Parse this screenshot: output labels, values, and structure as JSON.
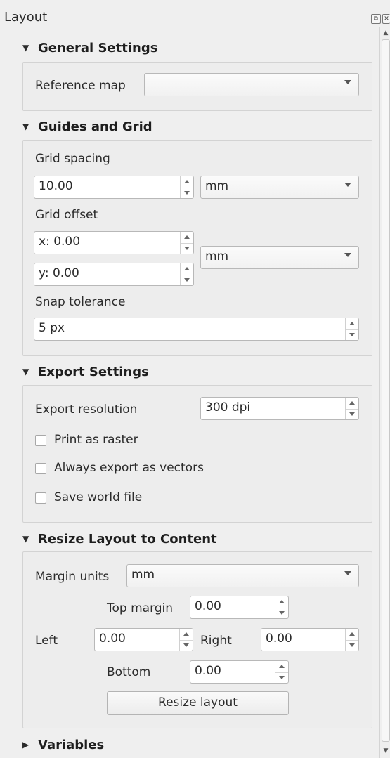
{
  "panel": {
    "title": "Layout"
  },
  "general": {
    "header": "General Settings",
    "reference_map_label": "Reference map",
    "reference_map_value": ""
  },
  "guides": {
    "header": "Guides and Grid",
    "grid_spacing_label": "Grid spacing",
    "grid_spacing_value": "10.00",
    "grid_spacing_unit": "mm",
    "grid_offset_label": "Grid offset",
    "offset_x": "x: 0.00",
    "offset_y": "y: 0.00",
    "offset_unit": "mm",
    "snap_label": "Snap tolerance",
    "snap_value": "5 px"
  },
  "export": {
    "header": "Export Settings",
    "resolution_label": "Export resolution",
    "resolution_value": "300 dpi",
    "print_raster": "Print as raster",
    "always_vectors": "Always export as vectors",
    "world_file": "Save world file"
  },
  "resize": {
    "header": "Resize Layout to Content",
    "margin_units_label": "Margin units",
    "margin_units_value": "mm",
    "top_label": "Top margin",
    "top_value": "0.00",
    "left_label": "Left",
    "left_value": "0.00",
    "right_label": "Right",
    "right_value": "0.00",
    "bottom_label": "Bottom",
    "bottom_value": "0.00",
    "button": "Resize layout"
  },
  "variables": {
    "header": "Variables"
  },
  "icons": {
    "expanded": "▼",
    "collapsed": "▶",
    "float": "⧉",
    "close": "✕",
    "scroll_up": "▲",
    "scroll_down": "▼"
  }
}
